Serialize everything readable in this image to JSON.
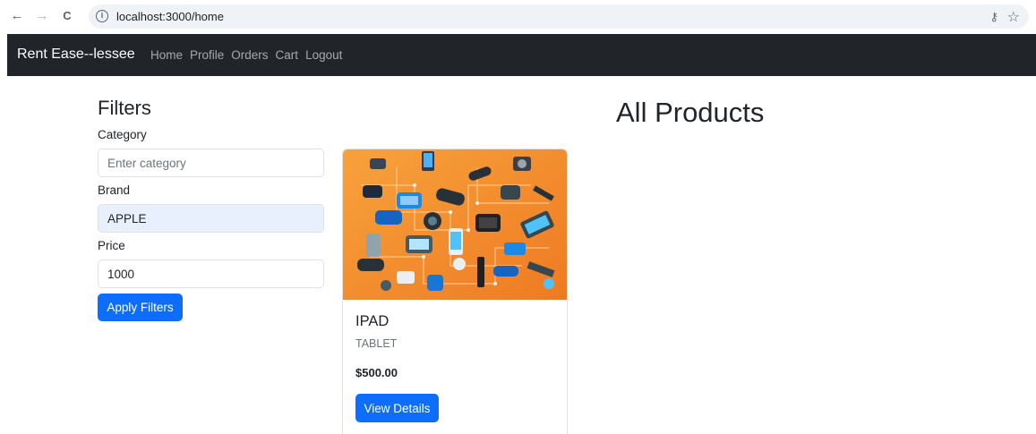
{
  "browser": {
    "url": "localhost:3000/home",
    "back_icon": "←",
    "forward_icon": "→",
    "reload_icon": "C",
    "info_icon": "i",
    "key_icon": "⚷",
    "star_icon": "☆"
  },
  "navbar": {
    "brand": "Rent Ease--lessee",
    "links": [
      "Home",
      "Profile",
      "Orders",
      "Cart",
      "Logout"
    ]
  },
  "filters": {
    "title": "Filters",
    "category_label": "Category",
    "category_placeholder": "Enter category",
    "category_value": "",
    "brand_label": "Brand",
    "brand_value": "APPLE",
    "price_label": "Price",
    "price_value": "1000",
    "apply_label": "Apply Filters"
  },
  "products": {
    "title": "All Products",
    "items": [
      {
        "name": "IPAD",
        "category": "TABLET",
        "price": "$500.00",
        "button": "View Details"
      }
    ]
  },
  "colors": {
    "navbar": "#212529",
    "primary": "#0d6efd",
    "image_bg": "#f18a2a"
  }
}
